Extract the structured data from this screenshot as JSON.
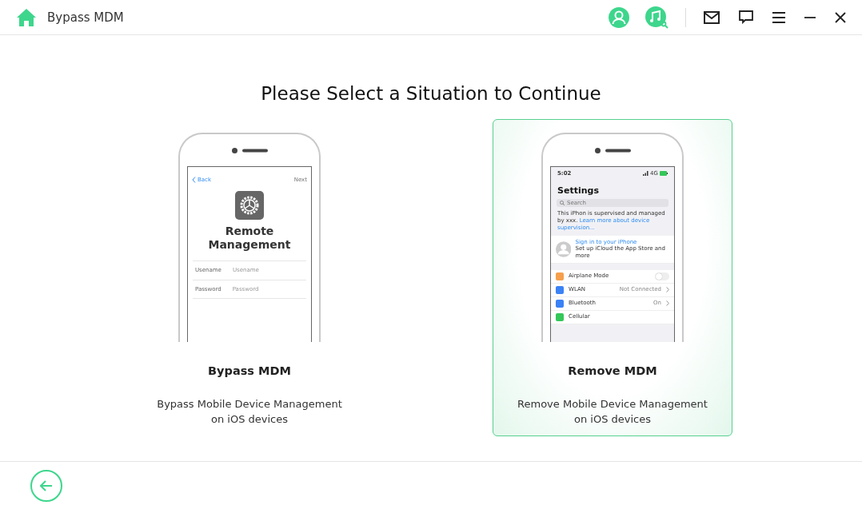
{
  "app": {
    "title": "Bypass MDM"
  },
  "heading": "Please Select a Situation to Continue",
  "options": [
    {
      "title": "Bypass MDM",
      "description": "Bypass Mobile Device Management on iOS devices",
      "selected": false,
      "screen": {
        "kind": "login",
        "back": "Back",
        "next": "Next",
        "title": "Remote Management",
        "fields": [
          {
            "label": "Usename",
            "placeholder": "Usename"
          },
          {
            "label": "Password",
            "placeholder": "Password"
          }
        ]
      }
    },
    {
      "title": "Remove MDM",
      "description": "Remove Mobile Device Management on iOS devices",
      "selected": true,
      "screen": {
        "kind": "settings",
        "time": "5:02",
        "network": "4G",
        "title": "Settings",
        "search": "Search",
        "notice": "This iPhon is supervised and managed by xxx.",
        "link": "Learn more about device supervision...",
        "account_title": "Sign in to your iPhone",
        "account_subtitle": "Set up iCloud the App Store and more",
        "rows": [
          {
            "label": "Airplane Mode",
            "kind": "toggle",
            "on": false,
            "color": "#f6a04d"
          },
          {
            "label": "WLAN",
            "kind": "value",
            "value": "Not Connected",
            "color": "#3b82f6"
          },
          {
            "label": "Bluetooth",
            "kind": "value",
            "value": "On",
            "color": "#3b82f6"
          },
          {
            "label": "Cellular",
            "kind": "plain",
            "color": "#34c759"
          }
        ]
      }
    }
  ]
}
